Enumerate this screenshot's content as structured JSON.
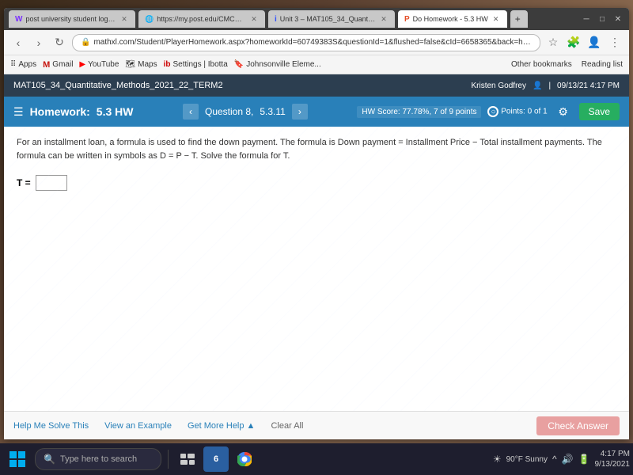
{
  "desktop": {
    "bg_color": "#5a4030"
  },
  "browser": {
    "tabs": [
      {
        "id": "tab1",
        "label": "post university student login - Y...",
        "active": false,
        "icon": "Y"
      },
      {
        "id": "tab2",
        "label": "https://my.post.edu/CMCPortal/...",
        "active": false,
        "icon": "C"
      },
      {
        "id": "tab3",
        "label": "Unit 3 – MAT105_34_Quantitati...",
        "active": false,
        "icon": "i"
      },
      {
        "id": "tab4",
        "label": "Do Homework - 5.3 HW",
        "active": true,
        "icon": "P"
      },
      {
        "id": "tab5",
        "label": "+",
        "active": false,
        "icon": ""
      }
    ],
    "url": "mathxl.com/Student/PlayerHomework.aspx?homeworkId=60749383S&questionId=1&flushed=false&cId=6658365&back=https://www.mathxl.com/Student/...",
    "bookmarks": [
      "Apps",
      "Gmail",
      "YouTube",
      "Maps",
      "Settings | Ibotta",
      "Johnsonville Eleme...",
      "Other bookmarks",
      "Reading list"
    ]
  },
  "course": {
    "title": "MAT105_34_Quantitative_Methods_2021_22_TERM2",
    "student": "Kristen Godfrey",
    "date": "09/13/21 4:17 PM"
  },
  "homework": {
    "title": "Homework:",
    "name": "5.3 HW",
    "question_label": "Question 8,",
    "question_section": "5.3.11",
    "hw_score_label": "HW Score:",
    "hw_score": "77.78%,",
    "hw_score_detail": "7 of 9 points",
    "points_label": "Points:",
    "points_value": "0 of 1"
  },
  "problem": {
    "text": "For an installment loan, a formula is used to find the down payment. The formula is Down payment = Installment Price − Total installment payments. The formula can be written in symbols as D = P − T. Solve the formula for T.",
    "answer_label": "T =",
    "answer_placeholder": ""
  },
  "bottom_bar": {
    "help_me_solve": "Help Me Solve This",
    "view_example": "View an Example",
    "get_more_help": "Get More Help ▲",
    "clear_all": "Clear All",
    "check_answer": "Check Answer"
  },
  "taskbar": {
    "search_placeholder": "Type here to search",
    "weather": "90°F Sunny",
    "time": "4:17 PM",
    "date": "9/13/2021"
  }
}
